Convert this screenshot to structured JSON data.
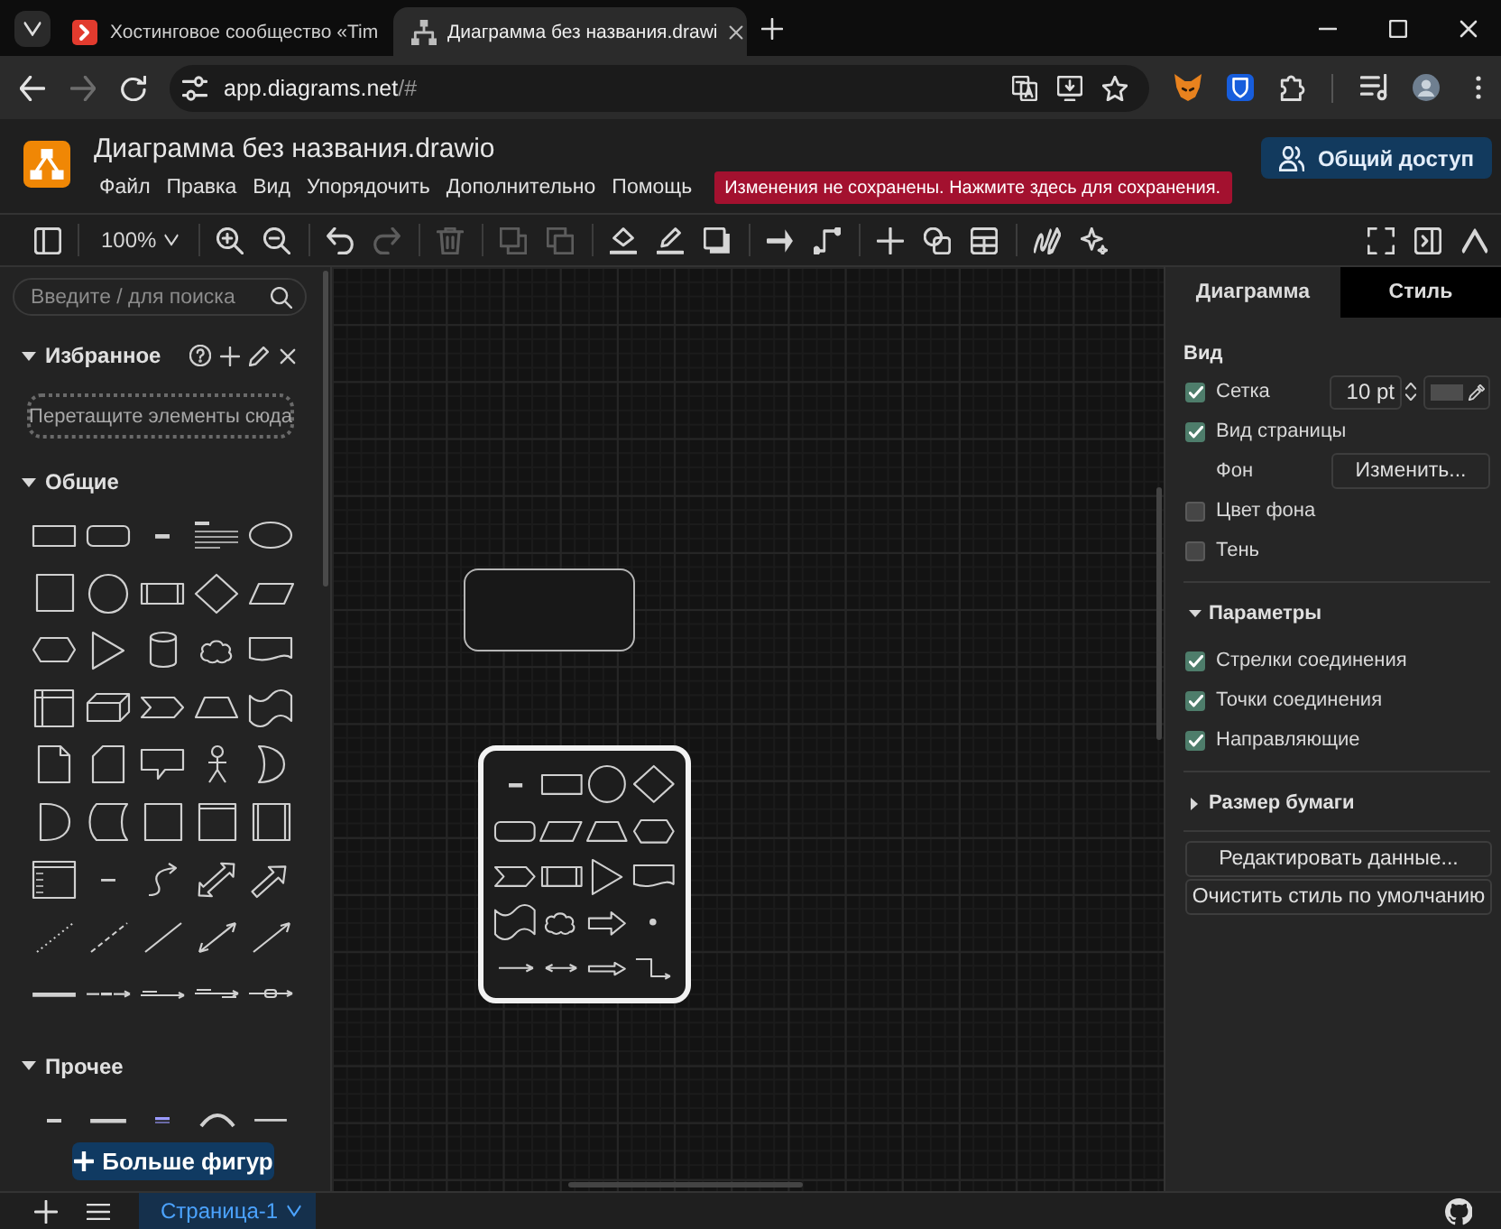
{
  "browser": {
    "tabs": [
      {
        "kind": "site",
        "title": "Хостинговое сообщество «Tim",
        "selected": false
      },
      {
        "kind": "diagram",
        "title": "Диаграмма без названия.drawi",
        "selected": true
      }
    ],
    "nav": [
      {
        "kind": "back",
        "disabled": false
      },
      {
        "kind": "forward",
        "disabled": true
      },
      {
        "kind": "reload",
        "disabled": false
      }
    ],
    "address": {
      "host": "app.diagrams.net",
      "path": "/#"
    }
  },
  "app": {
    "title": "Диаграмма без названия.drawio",
    "menu": [
      "Файл",
      "Правка",
      "Вид",
      "Упорядочить",
      "Дополнительно",
      "Помощь"
    ],
    "unsaved_notice": "Изменения не сохранены. Нажмите здесь для сохранения.",
    "share_button": "Общий доступ"
  },
  "toolbar": {
    "groups": [
      [
        {
          "kind": "sidebar",
          "disabled": false
        }
      ],
      [
        {
          "kind": "zoom",
          "label": "100%",
          "disabled": false
        }
      ],
      [
        {
          "kind": "zoom_in",
          "disabled": false
        },
        {
          "kind": "zoom_out",
          "disabled": false
        }
      ],
      [
        {
          "kind": "undo",
          "disabled": false
        },
        {
          "kind": "redo",
          "disabled": true
        }
      ],
      [
        {
          "kind": "delete",
          "disabled": true
        }
      ],
      [
        {
          "kind": "to_front",
          "disabled": true
        },
        {
          "kind": "to_back",
          "disabled": true
        }
      ],
      [
        {
          "kind": "fill",
          "disabled": false
        },
        {
          "kind": "line",
          "disabled": false
        },
        {
          "kind": "shadow",
          "disabled": false
        }
      ],
      [
        {
          "kind": "connector",
          "disabled": false
        },
        {
          "kind": "waypoints",
          "disabled": false
        }
      ],
      [
        {
          "kind": "insert",
          "disabled": false
        },
        {
          "kind": "shapes",
          "disabled": false
        },
        {
          "kind": "table",
          "disabled": false
        }
      ],
      [
        {
          "kind": "freehand",
          "disabled": false
        },
        {
          "kind": "generate",
          "disabled": false
        }
      ]
    ],
    "right": [
      {
        "kind": "fullscreen",
        "disabled": false
      },
      {
        "kind": "format",
        "disabled": false
      },
      {
        "kind": "collapse",
        "disabled": false
      }
    ]
  },
  "sidebar": {
    "search": {
      "placeholder": "Введите / для поиска"
    },
    "sections": [
      {
        "kind": "favorites",
        "title": "Избранное",
        "expanded": true,
        "drop_hint": "Перетащите элементы сюда"
      },
      {
        "kind": "general",
        "title": "Общие",
        "expanded": true
      },
      {
        "kind": "misc",
        "title": "Прочее",
        "expanded": true
      }
    ],
    "more_shapes": "Больше фигур"
  },
  "format_panel": {
    "tabs": [
      {
        "label": "Диаграмма",
        "selected": true
      },
      {
        "label": "Стиль",
        "selected": false
      }
    ],
    "sections": [
      {
        "kind": "view",
        "title": "Вид",
        "rows": [
          {
            "kind": "grid",
            "label": "Сетка",
            "checked": true,
            "size": "10 pt"
          },
          {
            "kind": "checkbox",
            "label": "Вид страницы",
            "checked": true
          },
          {
            "kind": "button",
            "label": "Фон",
            "button": "Изменить..."
          },
          {
            "kind": "checkbox",
            "label": "Цвет фона",
            "checked": false
          },
          {
            "kind": "checkbox",
            "label": "Тень",
            "checked": false
          }
        ]
      },
      {
        "kind": "options",
        "title": "Параметры",
        "expanded": true,
        "rows": [
          {
            "kind": "checkbox",
            "label": "Стрелки соединения",
            "checked": true
          },
          {
            "kind": "checkbox",
            "label": "Точки соединения",
            "checked": true
          },
          {
            "kind": "checkbox",
            "label": "Направляющие",
            "checked": true
          }
        ]
      },
      {
        "kind": "paper",
        "title": "Размер бумаги",
        "expanded": false
      }
    ],
    "buttons": [
      "Редактировать данные...",
      "Очистить стиль по умолчанию"
    ]
  },
  "footer": {
    "pages": [
      {
        "label": "Страница-1",
        "selected": true
      }
    ]
  }
}
